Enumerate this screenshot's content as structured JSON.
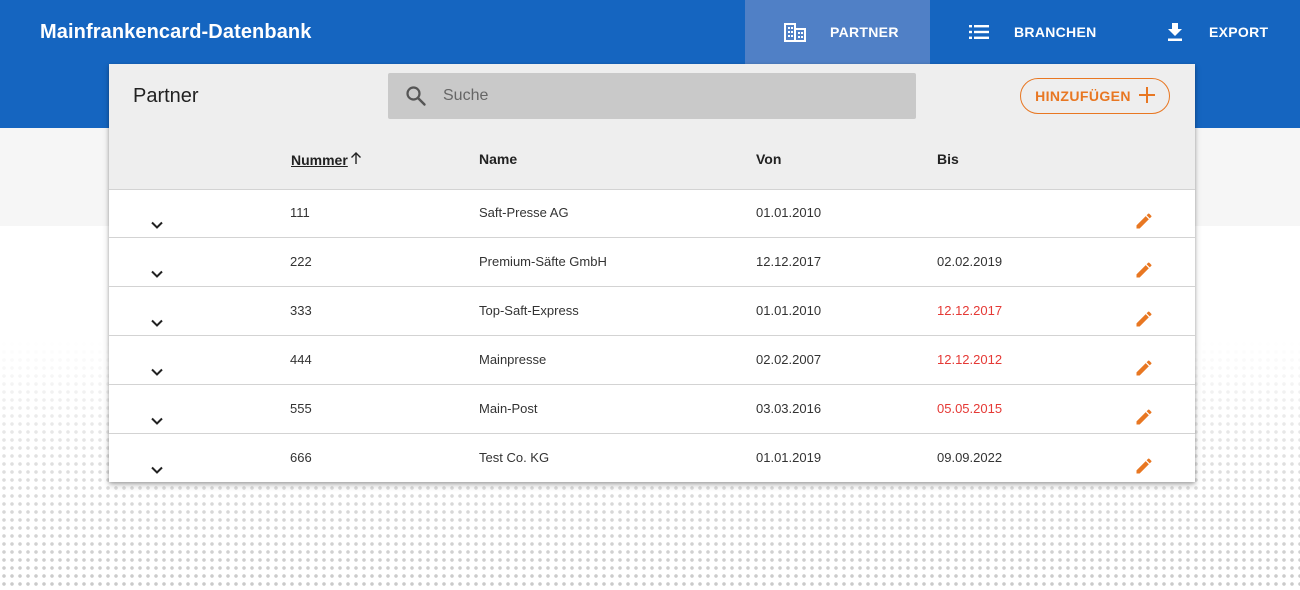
{
  "app": {
    "title": "Mainfrankencard-Datenbank"
  },
  "nav": [
    {
      "label": "PARTNER",
      "icon": "building-icon",
      "active": true
    },
    {
      "label": "BRANCHEN",
      "icon": "list-icon",
      "active": false
    },
    {
      "label": "EXPORT",
      "icon": "download-icon",
      "active": false
    }
  ],
  "card": {
    "title": "Partner",
    "search": {
      "placeholder": "Suche",
      "value": ""
    },
    "add_button_label": "HINZUFÜGEN"
  },
  "table": {
    "columns": {
      "nummer": "Nummer",
      "name": "Name",
      "von": "Von",
      "bis": "Bis"
    },
    "sort": {
      "column": "Nummer",
      "direction": "ascending"
    },
    "rows": [
      {
        "nummer": "111",
        "name": "Saft-Presse AG",
        "von": "01.01.2010",
        "bis": "",
        "expired": false
      },
      {
        "nummer": "222",
        "name": "Premium-Säfte GmbH",
        "von": "12.12.2017",
        "bis": "02.02.2019",
        "expired": false
      },
      {
        "nummer": "333",
        "name": "Top-Saft-Express",
        "von": "01.01.2010",
        "bis": "12.12.2017",
        "expired": true
      },
      {
        "nummer": "444",
        "name": "Mainpresse",
        "von": "02.02.2007",
        "bis": "12.12.2012",
        "expired": true
      },
      {
        "nummer": "555",
        "name": "Main-Post",
        "von": "03.03.2016",
        "bis": "05.05.2015",
        "expired": true
      },
      {
        "nummer": "666",
        "name": "Test Co. KG",
        "von": "01.01.2019",
        "bis": "09.09.2022",
        "expired": false
      }
    ]
  },
  "colors": {
    "primary": "#1565c0",
    "active_tab": "#5080c6",
    "accent": "#e87722",
    "expired": "#e53935"
  }
}
